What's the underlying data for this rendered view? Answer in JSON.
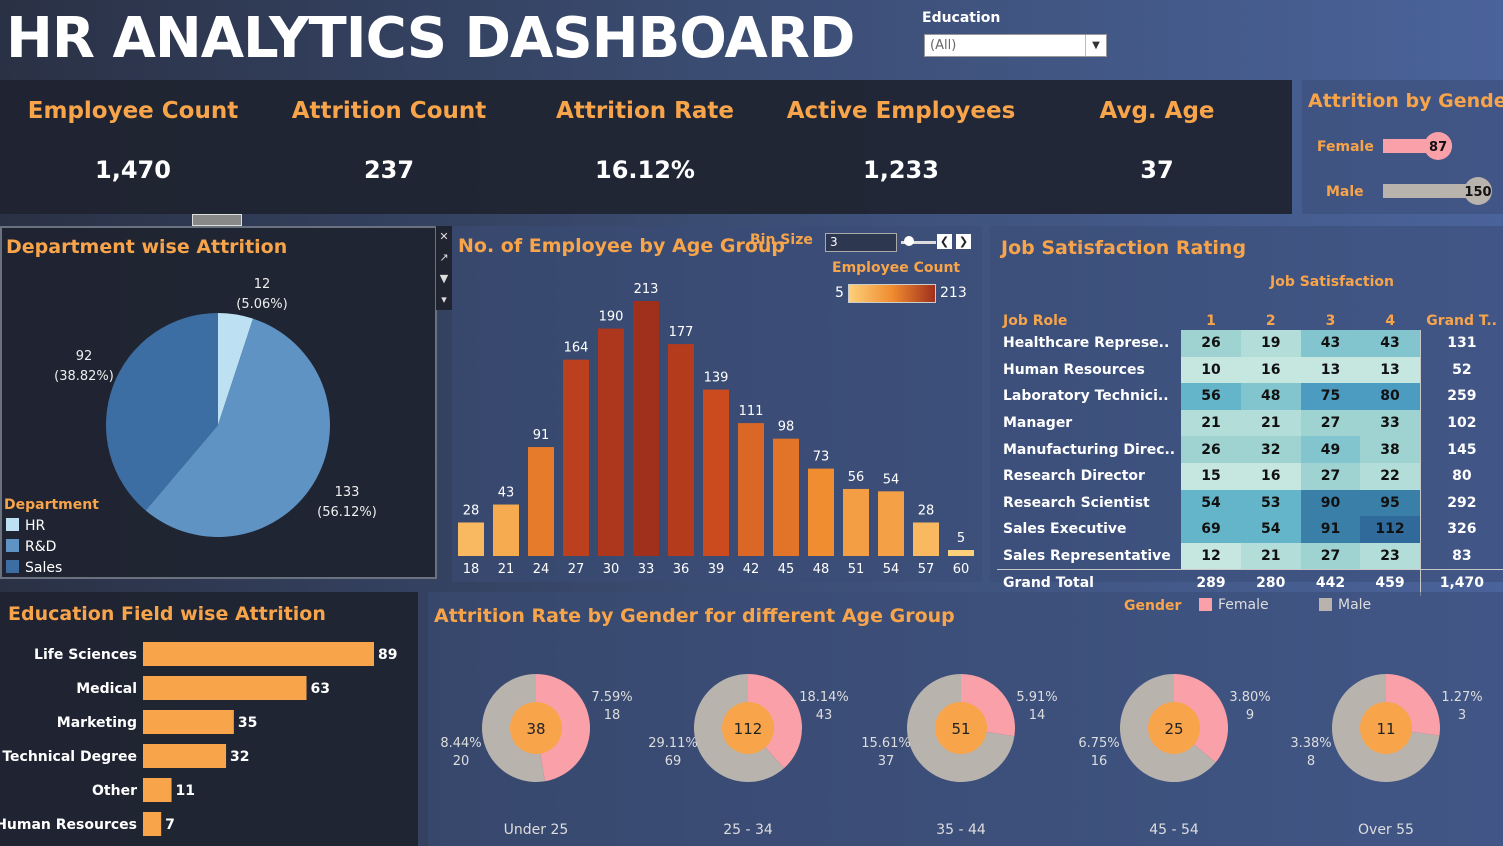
{
  "header": {
    "title": "HR ANALYTICS DASHBOARD",
    "education_filter": {
      "label": "Education",
      "value": "(All)"
    }
  },
  "kpis": [
    {
      "label": "Employee Count",
      "value": "1,470"
    },
    {
      "label": "Attrition Count",
      "value": "237"
    },
    {
      "label": "Attrition Rate",
      "value": "16.12%"
    },
    {
      "label": "Active Employees",
      "value": "1,233"
    },
    {
      "label": "Avg. Age",
      "value": "37"
    }
  ],
  "gender_attrition": {
    "title": "Attrition by Gender",
    "bars": [
      {
        "label": "Female",
        "value": 87,
        "value_label": "87",
        "color": "#f9a0a8"
      },
      {
        "label": "Male",
        "value": 150,
        "value_label": "150",
        "color": "#b9b3ae"
      }
    ]
  },
  "department": {
    "title": "Department wise Attrition",
    "legend_title": "Department",
    "slices": [
      {
        "name": "HR",
        "value": 12,
        "pct": "(5.06%)",
        "color": "#bde0f2"
      },
      {
        "name": "R&D",
        "value": 133,
        "pct": "(56.12%)",
        "color": "#5f93c3"
      },
      {
        "name": "Sales",
        "value": 92,
        "pct": "(38.82%)",
        "color": "#3d6ea3"
      }
    ]
  },
  "age_group": {
    "title": "No. of Employee by Age Group",
    "bin_label": "Bin Size",
    "bin_value": "3",
    "legend_title": "Employee Count",
    "legend_min": "5",
    "legend_max": "213"
  },
  "chart_data": [
    {
      "type": "pie",
      "title": "Department wise Attrition",
      "categories": [
        "HR",
        "R&D",
        "Sales"
      ],
      "values": [
        12,
        133,
        92
      ]
    },
    {
      "type": "bar",
      "title": "No. of Employee by Age Group",
      "categories": [
        "18",
        "21",
        "24",
        "27",
        "30",
        "33",
        "36",
        "39",
        "42",
        "45",
        "48",
        "51",
        "54",
        "57",
        "60"
      ],
      "values": [
        28,
        43,
        91,
        164,
        190,
        213,
        177,
        139,
        111,
        98,
        73,
        56,
        54,
        28,
        5
      ]
    },
    {
      "type": "bar",
      "title": "Education Field wise Attrition",
      "categories": [
        "Life Sciences",
        "Medical",
        "Marketing",
        "Technical Degree",
        "Other",
        "Human Resources"
      ],
      "values": [
        89,
        63,
        35,
        32,
        11,
        7
      ]
    },
    {
      "type": "table",
      "title": "Job Satisfaction Rating",
      "column_header": "Job Satisfaction",
      "columns": [
        "Job Role",
        "1",
        "2",
        "3",
        "4",
        "Grand T.."
      ],
      "rows": [
        [
          "Healthcare Represe..",
          26,
          19,
          43,
          43,
          131
        ],
        [
          "Human Resources",
          10,
          16,
          13,
          13,
          52
        ],
        [
          "Laboratory Technici..",
          56,
          48,
          75,
          80,
          259
        ],
        [
          "Manager",
          21,
          21,
          27,
          33,
          102
        ],
        [
          "Manufacturing Direc..",
          26,
          32,
          49,
          38,
          145
        ],
        [
          "Research Director",
          15,
          16,
          27,
          22,
          80
        ],
        [
          "Research Scientist",
          54,
          53,
          90,
          95,
          292
        ],
        [
          "Sales Executive",
          69,
          54,
          91,
          112,
          326
        ],
        [
          "Sales Representative",
          12,
          21,
          27,
          23,
          83
        ]
      ],
      "total": [
        "Grand Total",
        "289",
        "280",
        "442",
        "459",
        "1,470"
      ]
    },
    {
      "type": "pie",
      "title": "Attrition Rate by Gender for different Age Group",
      "legend_title": "Gender",
      "series": [
        {
          "name": "Female",
          "color": "#f9a0a8"
        },
        {
          "name": "Male",
          "color": "#b9b3ae"
        }
      ],
      "groups": [
        {
          "label": "Under 25",
          "total": "38",
          "female": 18,
          "female_pct": "7.59%",
          "male": 20,
          "male_pct": "8.44%"
        },
        {
          "label": "25 - 34",
          "total": "112",
          "female": 43,
          "female_pct": "18.14%",
          "male": 69,
          "male_pct": "29.11%"
        },
        {
          "label": "35 - 44",
          "total": "51",
          "female": 14,
          "female_pct": "5.91%",
          "male": 37,
          "male_pct": "15.61%"
        },
        {
          "label": "45 - 54",
          "total": "25",
          "female": 9,
          "female_pct": "3.80%",
          "male": 16,
          "male_pct": "6.75%"
        },
        {
          "label": "Over 55",
          "total": "11",
          "female": 3,
          "female_pct": "1.27%",
          "male": 8,
          "male_pct": "3.38%"
        }
      ]
    }
  ]
}
